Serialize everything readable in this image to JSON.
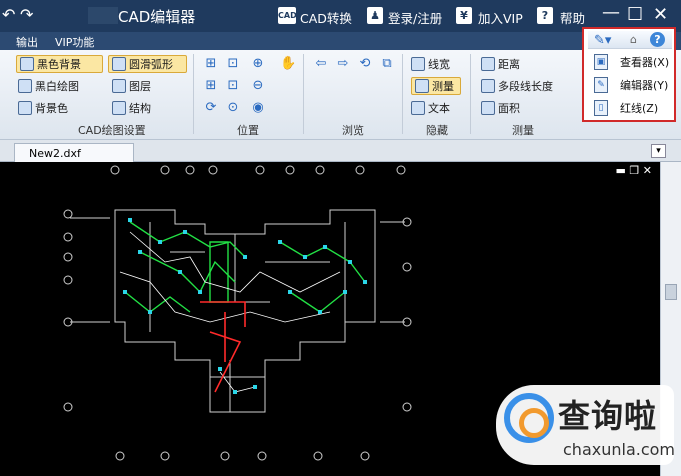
{
  "titlebar": {
    "undo_glyph": "↶",
    "redo_glyph": "↷",
    "app_title": "CAD编辑器",
    "cad_convert_icon": "CAD",
    "cad_convert": "CAD转换",
    "login_icon": "user-icon",
    "login": "登录/注册",
    "vip_icon": "¥",
    "vip": "加入VIP",
    "help_icon": "?",
    "help": "帮助",
    "minimize": "—",
    "maximize": "☐",
    "close": "✕"
  },
  "menubar": {
    "items": [
      "输出",
      "VIP功能"
    ]
  },
  "ribbon": {
    "cad_settings": {
      "label": "CAD绘图设置",
      "items": [
        "黑色背景",
        "圆滑弧形",
        "黑白绘图",
        "图层",
        "背景色",
        "结构"
      ]
    },
    "position": {
      "label": "位置"
    },
    "browse": {
      "label": "浏览"
    },
    "hide": {
      "label": "隐藏",
      "items": [
        "线宽",
        "测量",
        "文本"
      ]
    },
    "measure": {
      "label": "测量",
      "items": [
        "距离",
        "多段线长度",
        "面积"
      ]
    }
  },
  "dropdown": {
    "help_glyph": "?",
    "home_glyph": "⌂",
    "items": [
      {
        "label": "查看器(X)",
        "icon": "viewer-icon"
      },
      {
        "label": "编辑器(Y)",
        "icon": "editor-icon"
      },
      {
        "label": "红线(Z)",
        "icon": "redline-icon"
      }
    ]
  },
  "tabs": {
    "active": "New2.dxf",
    "dropdown_glyph": "▾"
  },
  "canvas": {
    "ctrls": "▬ ❐ ✕"
  },
  "watermark": {
    "brand": "查询啦",
    "url": "chaxunla.com"
  },
  "colors": {
    "title": "#1f3a5e",
    "canvas": "#000000",
    "highlight": "#d12a2a"
  }
}
